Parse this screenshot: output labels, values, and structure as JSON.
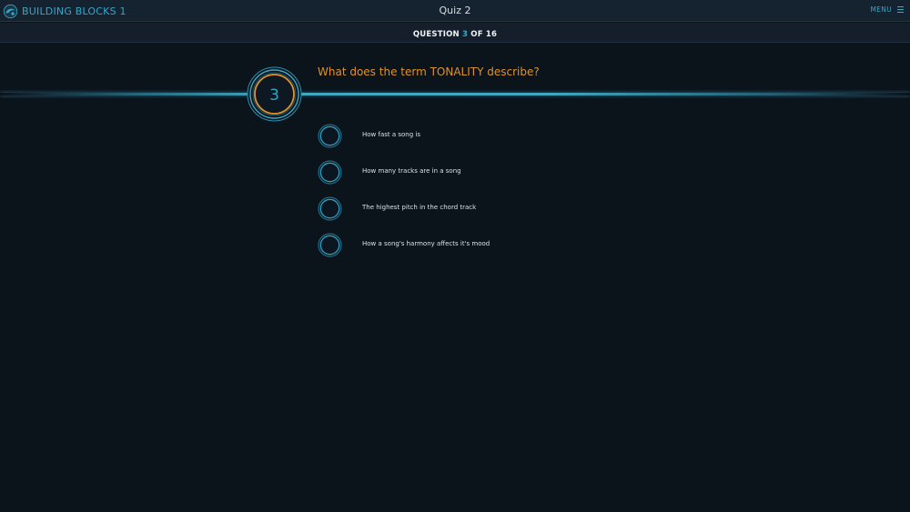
{
  "header": {
    "app_title": "BUILDING BLOCKS 1",
    "quiz_title": "Quiz 2",
    "menu_label": "MENU"
  },
  "progress": {
    "prefix": "QUESTION",
    "current": "3",
    "suffix": "OF 16",
    "current_number": 3,
    "total": 16
  },
  "question": {
    "number": "3",
    "text": "What does the term TONALITY describe?"
  },
  "options": [
    {
      "label": "How fast a song is",
      "selected": false
    },
    {
      "label": "How many tracks are in a song",
      "selected": false
    },
    {
      "label": "The highest pitch in the chord track",
      "selected": false
    },
    {
      "label": "How a song's harmony affects it's mood",
      "selected": false
    }
  ],
  "colors": {
    "accent": "#35a7c7",
    "question": "#e0922a",
    "background": "#0b131b",
    "badge_ring": "#e0922a"
  },
  "icons": {
    "brand": "brand-logo-icon",
    "menu": "hamburger-icon",
    "radio": "radio-circle-icon"
  }
}
